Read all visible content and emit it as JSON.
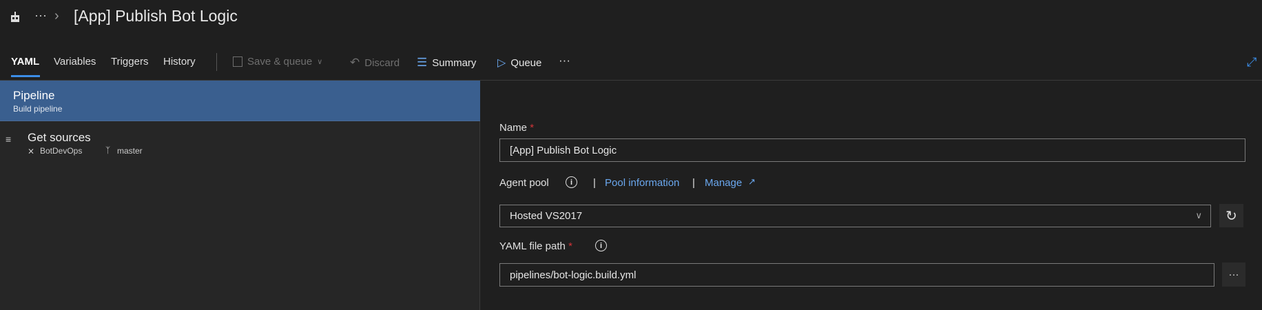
{
  "header": {
    "title": "[App] Publish Bot Logic",
    "more": "···",
    "sep": "›"
  },
  "tabs": [
    {
      "label": "YAML",
      "active": true
    },
    {
      "label": "Variables"
    },
    {
      "label": "Triggers"
    },
    {
      "label": "History"
    }
  ],
  "toolbar": {
    "save_queue": "Save & queue",
    "discard": "Discard",
    "summary": "Summary",
    "queue": "Queue",
    "more": "···"
  },
  "left": {
    "pipeline": {
      "title": "Pipeline",
      "subtitle": "Build pipeline"
    },
    "get_sources": {
      "title": "Get sources",
      "repo": "BotDevOps",
      "branch": "master"
    }
  },
  "form": {
    "name_label": "Name",
    "required": "*",
    "name_value": "[App] Publish Bot Logic",
    "agent_pool_label": "Agent pool",
    "pool_info": "Pool information",
    "manage": "Manage",
    "pipe": "|",
    "agent_pool_value": "Hosted VS2017",
    "yaml_label": "YAML file path",
    "yaml_value": "pipelines/bot-logic.build.yml",
    "browse": "···"
  },
  "colors": {
    "accent": "#6aa7ee",
    "selected": "#3a5f8f",
    "required": "#d13438"
  }
}
